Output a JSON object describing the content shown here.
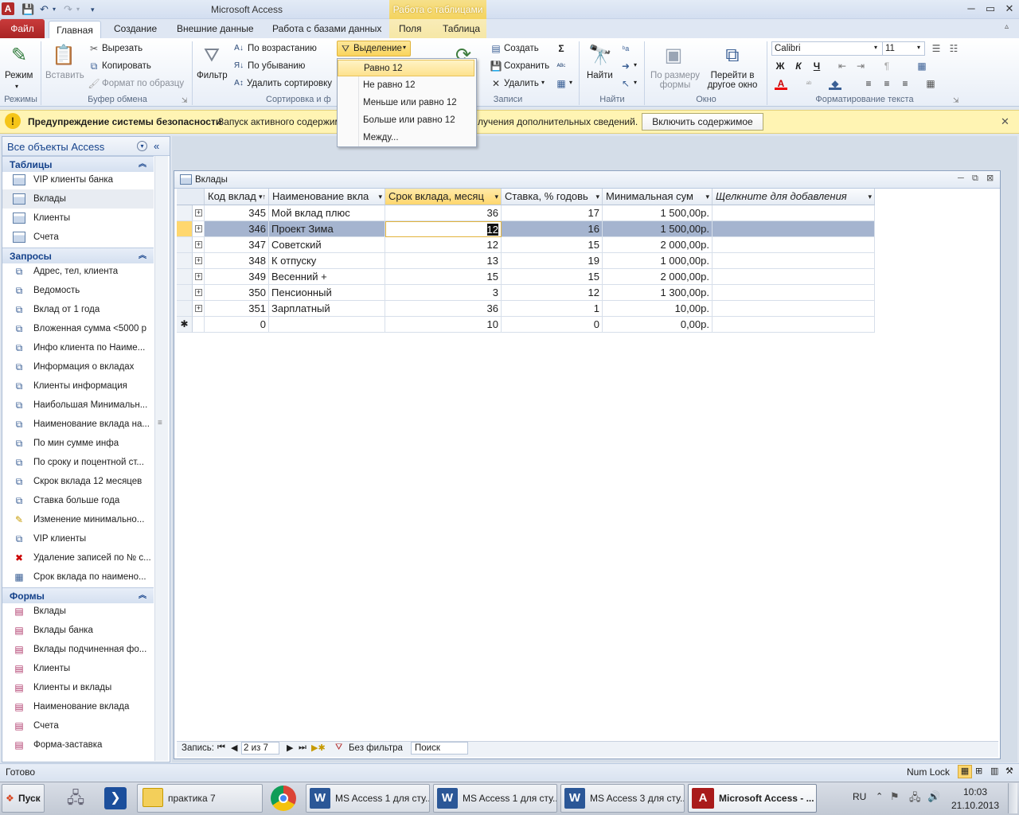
{
  "window": {
    "title": "Microsoft Access",
    "context_tab_title": "Работа с таблицами"
  },
  "tabs": {
    "file": "Файл",
    "items": [
      "Главная",
      "Создание",
      "Внешние данные",
      "Работа с базами данных",
      "Поля",
      "Таблица"
    ]
  },
  "ribbon": {
    "mode": "Режим",
    "paste": "Вставить",
    "cut": "Вырезать",
    "copy": "Копировать",
    "format_painter": "Формат по образцу",
    "filter": "Фильтр",
    "sort_asc": "По возрастанию",
    "sort_desc": "По убыванию",
    "remove_sort": "Удалить сортировку",
    "selection": "Выделение",
    "create": "Создать",
    "save": "Сохранить",
    "delete": "Удалить",
    "find": "Найти",
    "fit_form": "По размеру формы",
    "switch_window": "Перейти в другое окно",
    "font_name": "Calibri",
    "font_size": "11",
    "bold": "Ж",
    "italic": "К",
    "underline": "Ч",
    "groups": {
      "modes": "Режимы",
      "clipboard": "Буфер обмена",
      "sort_filter": "Сортировка и ф",
      "records": "Записи",
      "find": "Найти",
      "window": "Окно",
      "text_format": "Форматирование текста"
    }
  },
  "dropdown": {
    "items": [
      "Равно 12",
      "Не равно 12",
      "Меньше или равно 12",
      "Больше или равно 12",
      "Между..."
    ]
  },
  "security": {
    "title": "Предупреждение системы безопасности",
    "text_left": "Запуск активного содержим",
    "text_right": "лучения дополнительных сведений.",
    "button": "Включить содержимое"
  },
  "nav": {
    "header": "Все объекты Access",
    "groups": {
      "tables": "Таблицы",
      "queries": "Запросы",
      "forms": "Формы"
    },
    "tables": [
      "VIP клиенты банка",
      "Вклады",
      "Клиенты",
      "Счета"
    ],
    "queries": [
      "Адрес, тел, клиента",
      "Ведомость",
      "Вклад от 1 года",
      "Вложенная сумма <5000 р",
      "Инфо клиента по Наиме...",
      "Информация о вкладах",
      "Клиенты информация",
      "Наибольшая Минимальн...",
      "Наименование вклада на...",
      "По мин сумме инфа",
      "По сроку и поцентной ст...",
      "Скрок вклада 12 месяцев",
      "Ставка больше года",
      "Изменение минимально...",
      "VIP клиенты",
      "Удаление записей по № с...",
      "Срок вклада по наимено..."
    ],
    "forms": [
      "Вклады",
      "Вклады банка",
      "Вклады подчиненная фо...",
      "Клиенты",
      "Клиенты и вклады",
      "Наименование вклада",
      "Счета",
      "Форма-заставка"
    ]
  },
  "document": {
    "title": "Вклады",
    "columns": [
      "Код вклад",
      "Наименование вкла",
      "Срок вклада, месяц",
      "Ставка, % годовь",
      "Минимальная сум",
      "Щелкните для добавления"
    ],
    "rows": [
      [
        "345",
        "Мой вклад плюс",
        "36",
        "17",
        "1 500,00р."
      ],
      [
        "346",
        "Проект Зима",
        "12",
        "16",
        "1 500,00р."
      ],
      [
        "347",
        "Советский",
        "12",
        "15",
        "2 000,00р."
      ],
      [
        "348",
        "К отпуску",
        "13",
        "19",
        "1 000,00р."
      ],
      [
        "349",
        "Весенний +",
        "15",
        "15",
        "2 000,00р."
      ],
      [
        "350",
        "Пенсионный",
        "3",
        "12",
        "1 300,00р."
      ],
      [
        "351",
        "Зарплатный",
        "36",
        "1",
        "10,00р."
      ]
    ],
    "new_row": [
      "0",
      "",
      "10",
      "0",
      "0,00р."
    ],
    "new_row_marker": "✱"
  },
  "record_nav": {
    "label": "Запись:",
    "position": "2 из 7",
    "filter": "Без фильтра",
    "search": "Поиск"
  },
  "status": {
    "left": "Готово",
    "num_lock": "Num Lock"
  },
  "taskbar": {
    "start": "Пуск",
    "items": [
      "практика 7",
      "MS Access 1 для сту...",
      "MS Access 1 для сту...",
      "MS Access 3 для сту...",
      "Microsoft Access - ..."
    ],
    "lang": "RU",
    "time": "10:03",
    "date": "21.10.2013"
  }
}
